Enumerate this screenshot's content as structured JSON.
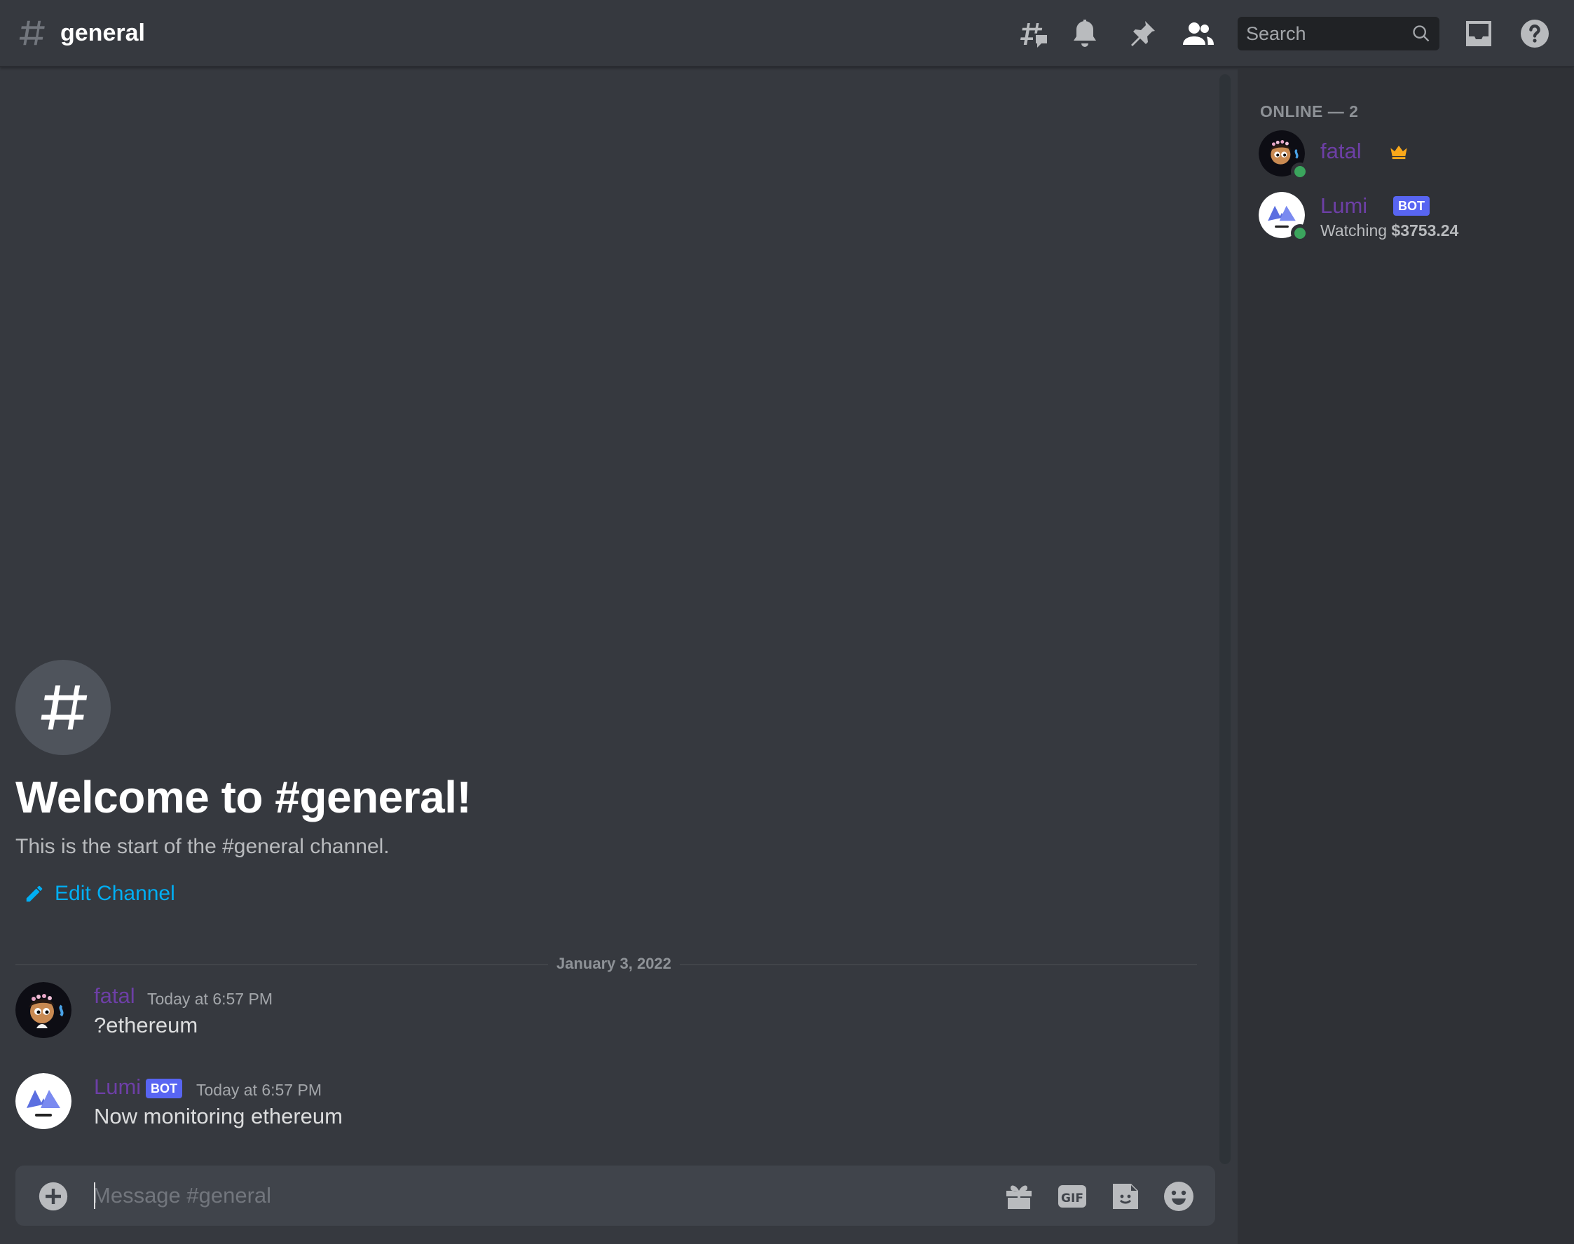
{
  "header": {
    "channel_name": "general",
    "search_placeholder": "Search",
    "icons": [
      "threads-icon",
      "bell-icon",
      "pin-icon",
      "members-icon",
      "search-icon",
      "inbox-icon",
      "help-icon"
    ]
  },
  "welcome": {
    "title": "Welcome to #general!",
    "subtitle": "This is the start of the #general channel.",
    "edit_label": "Edit Channel"
  },
  "divider_date": "January 3, 2022",
  "messages": [
    {
      "author": "fatal",
      "timestamp": "Today at 6:57 PM",
      "content": "?ethereum",
      "bot": false
    },
    {
      "author": "Lumi",
      "badge": "BOT",
      "timestamp": "Today at 6:57 PM",
      "content": "Now monitoring ethereum",
      "bot": true
    }
  ],
  "composer": {
    "placeholder": "Message #general",
    "icons": [
      "add-attachment-icon",
      "gift-icon",
      "gif-icon",
      "sticker-icon",
      "emoji-icon"
    ]
  },
  "members": {
    "heading": "ONLINE — 2",
    "list": [
      {
        "name": "fatal",
        "owner": true,
        "status": "online"
      },
      {
        "name": "Lumi",
        "badge": "BOT",
        "activity_prefix": "Watching",
        "activity_value": "$3753.24",
        "status": "online"
      }
    ]
  },
  "colors": {
    "background": "#36393f",
    "sidebar": "#2f3136",
    "username": "#6d3fa6",
    "link": "#00aff4",
    "bot_badge": "#5865f2",
    "online": "#3ba55d"
  }
}
